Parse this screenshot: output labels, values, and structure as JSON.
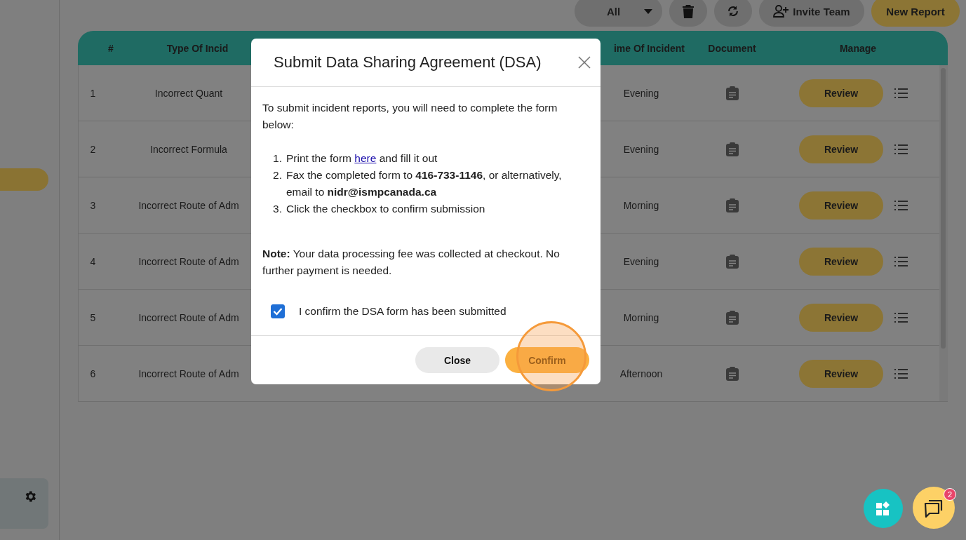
{
  "toolbar": {
    "filter": "All",
    "invite": "Invite Team",
    "new_report": "New Report"
  },
  "table": {
    "columns": [
      "#",
      "Type Of Incid",
      "ime Of Incident",
      "Document",
      "Manage"
    ],
    "rows": [
      {
        "num": "1",
        "type": "Incorrect Quant",
        "time": "Evening",
        "action": "Review"
      },
      {
        "num": "2",
        "type": "Incorrect Formula",
        "time": "Evening",
        "action": "Review"
      },
      {
        "num": "3",
        "type": "Incorrect Route of Adm",
        "time": "Morning",
        "action": "Review"
      },
      {
        "num": "4",
        "type": "Incorrect Route of Adm",
        "time": "Evening",
        "action": "Review"
      },
      {
        "num": "5",
        "type": "Incorrect Route of Adm",
        "time": "Morning",
        "action": "Review"
      },
      {
        "num": "6",
        "type": "Incorrect Route of Adm",
        "time": "Afternoon",
        "action": "Review"
      }
    ]
  },
  "modal": {
    "title": "Submit Data Sharing Agreement (DSA)",
    "intro": "To submit incident reports, you will need to complete the form below:",
    "steps": [
      {
        "marker": "1.",
        "before": "Print the form ",
        "link": "here",
        "after": " and fill it out"
      },
      {
        "marker": "2.",
        "text": "Fax the completed form to **416-733-1146**, or alternatively, email to **nidr@ismpcanada.ca**"
      },
      {
        "marker": "3.",
        "text": "Click the checkbox to confirm submission"
      }
    ],
    "note": "**Note:** Your data processing fee was collected at checkout. No further payment is needed.",
    "confirm_checkbox": {
      "label": "I confirm the DSA form has been submitted",
      "checked": true
    },
    "buttons": {
      "close": "Close",
      "confirm": "Confirm"
    }
  },
  "chat_badge": "2"
}
